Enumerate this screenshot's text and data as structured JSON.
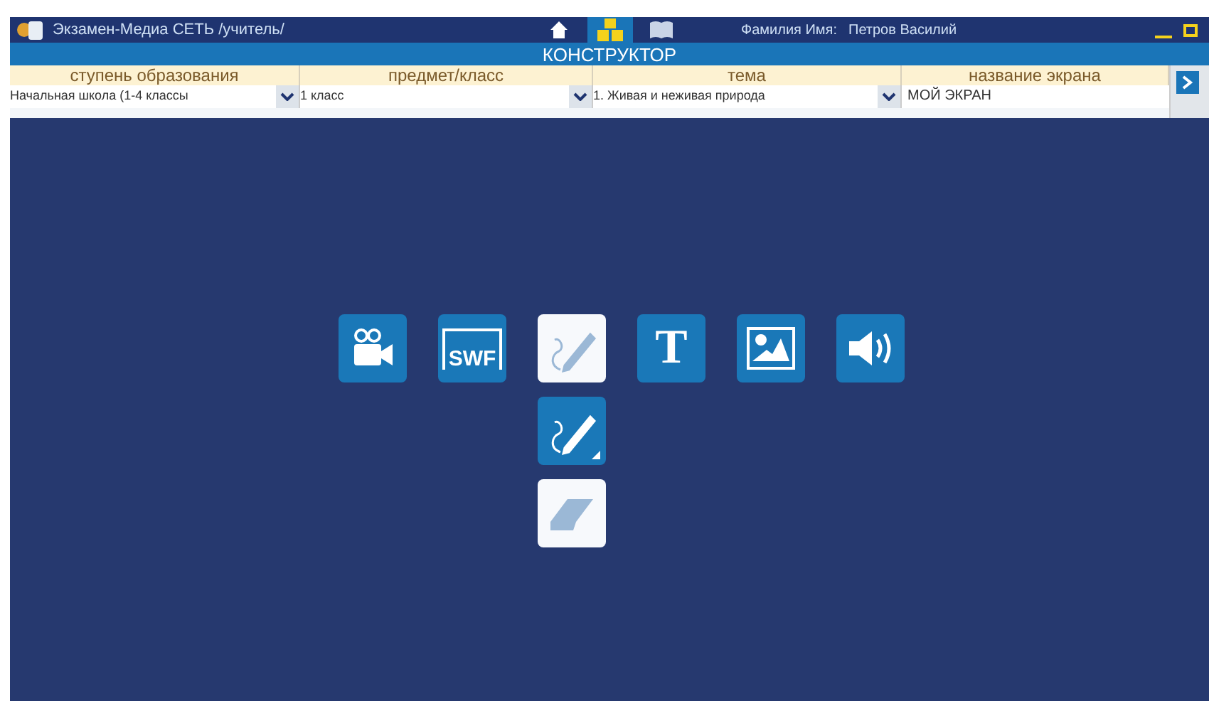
{
  "window": {
    "title": "Экзамен-Медиа СЕТЬ /учитель/",
    "user_label": "Фамилия Имя:",
    "user_name": "Петров Василий"
  },
  "nav": [
    {
      "kind": "home",
      "selected": false
    },
    {
      "kind": "constructor",
      "selected": true
    },
    {
      "kind": "book",
      "selected": false
    }
  ],
  "section_title": "КОНСТРУКТОР",
  "filters": [
    {
      "label": "ступень образования",
      "value": "Начальная школа (1-4 классы",
      "kind": "select"
    },
    {
      "label": "предмет/класс",
      "value": "1 класс",
      "kind": "select"
    },
    {
      "label": "тема",
      "value": "1. Живая и неживая природа",
      "kind": "select"
    },
    {
      "label": "название экрана",
      "value": "МОЙ ЭКРАН",
      "kind": "input"
    }
  ],
  "tools": [
    {
      "kind": "video",
      "selected": false
    },
    {
      "kind": "swf",
      "label": "SWF",
      "selected": false
    },
    {
      "kind": "pencil",
      "selected": true
    },
    {
      "kind": "text",
      "label": "T",
      "selected": false
    },
    {
      "kind": "image",
      "selected": false
    },
    {
      "kind": "sound",
      "selected": false
    }
  ],
  "subtools": [
    {
      "kind": "pencil",
      "selected": false
    },
    {
      "kind": "eraser",
      "selected": true
    }
  ]
}
